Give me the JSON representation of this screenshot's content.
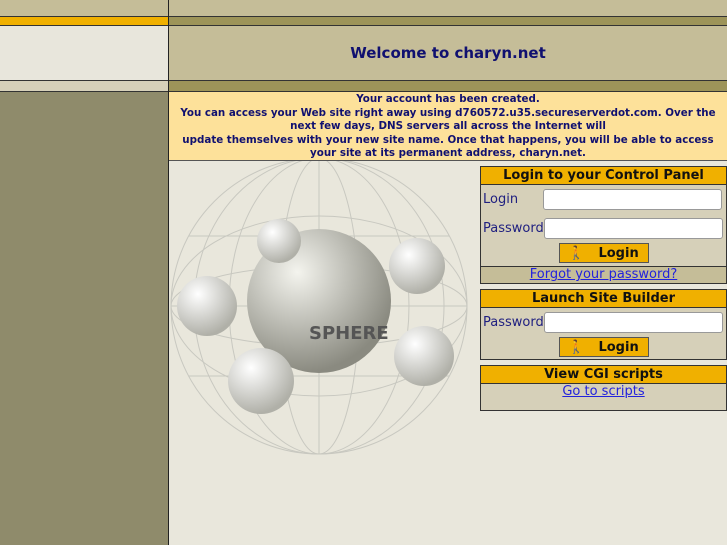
{
  "header": {
    "title": "Welcome to charyn.net"
  },
  "notice": {
    "lines": [
      "Your account has been created.",
      "You can access your Web site right away using d760572.u35.secureserverdot.com. Over the",
      "next few days, DNS servers all across the Internet will",
      "update themselves with your new site name. Once that happens, you will be able to access",
      "your site at its permanent address, charyn.net."
    ]
  },
  "graphic": {
    "label": "SPHERE"
  },
  "control_panel": {
    "title": "Login to your Control Panel",
    "login_label": "Login",
    "password_label": "Password",
    "login_value": "",
    "password_value": "",
    "button": "Login",
    "forgot": "Forgot your password?"
  },
  "site_builder": {
    "title": "Launch Site Builder",
    "password_label": "Password",
    "password_value": "",
    "button": "Login"
  },
  "cgi": {
    "title": "View CGI scripts",
    "link": "Go to scripts"
  },
  "colors": {
    "accent": "#f0b000",
    "title": "#101070",
    "notice_bg": "#fde19a"
  }
}
